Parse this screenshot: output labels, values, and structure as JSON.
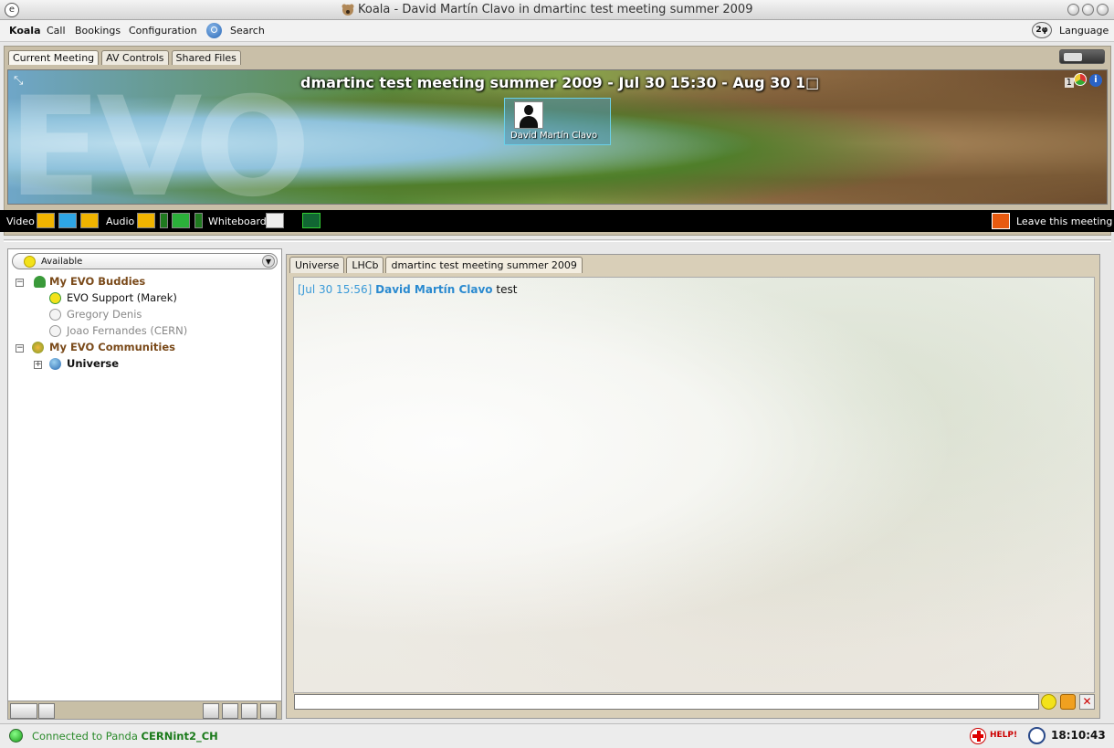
{
  "window": {
    "title": "Koala - David Martín Clavo in dmartinc test meeting summer 2009"
  },
  "menu": {
    "items": [
      "Koala",
      "Call",
      "Bookings",
      "Configuration",
      "Search"
    ],
    "language": "Language",
    "language_icon_text": "2φ"
  },
  "meeting_tabs": [
    "Current Meeting",
    "AV Controls",
    "Shared Files"
  ],
  "banner": {
    "watermark": "EVO",
    "meeting_title": "dmartinc test meeting summer 2009 - Jul 30 15:30 - Aug 30 1□",
    "participant_count": "1",
    "participant_name": "David Martín Clavo"
  },
  "controls": {
    "video_label": "Video",
    "audio_label": "Audio",
    "whiteboard_label": "Whiteboard",
    "leave_label": "Leave this meeting"
  },
  "status": {
    "value": "Available"
  },
  "tree": {
    "buddies_group": "My EVO Buddies",
    "buddies": [
      {
        "name": "EVO Support (Marek)",
        "state": "online"
      },
      {
        "name": "Gregory Denis",
        "state": "offline"
      },
      {
        "name": "Joao Fernandes (CERN)",
        "state": "offline"
      }
    ],
    "communities_group": "My EVO Communities",
    "communities": [
      {
        "name": "Universe"
      }
    ]
  },
  "chat_tabs": [
    "Universe",
    "LHCb",
    "dmartinc test meeting summer 2009"
  ],
  "chat": {
    "time": "[Jul 30 15:56]",
    "user": "David Martín Clavo",
    "message": "test"
  },
  "statusbar": {
    "connection_prefix": "Connected to Panda",
    "server": "CERNint2_CH",
    "help": "HELP!",
    "clock": "18:10:43"
  },
  "colors": {
    "accent": "#2a8ad0",
    "group": "#7a4a1a",
    "connected": "#2a8a2a",
    "help": "#cc0000"
  }
}
